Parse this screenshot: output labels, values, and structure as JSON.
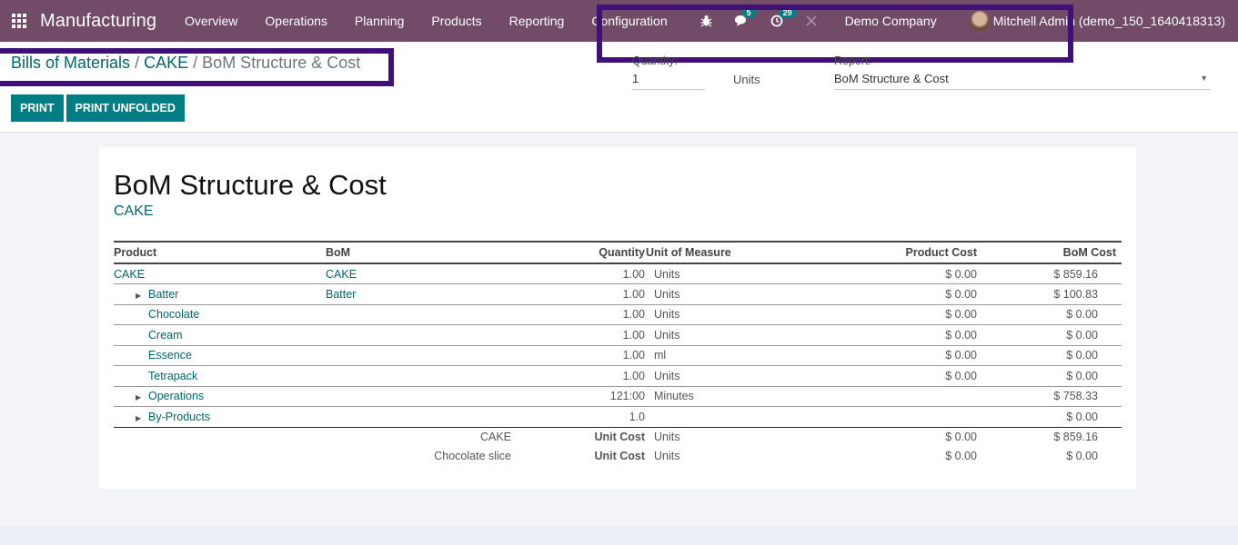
{
  "navbar": {
    "app_name": "Manufacturing",
    "menu": [
      "Overview",
      "Operations",
      "Planning",
      "Products",
      "Reporting",
      "Configuration"
    ],
    "messages_count": "5",
    "activities_count": "29",
    "company": "Demo Company",
    "user": "Mitchell Admin (demo_150_1640418313)"
  },
  "breadcrumb": {
    "items": [
      "Bills of Materials",
      "CAKE"
    ],
    "separator": "/",
    "active": "BoM Structure & Cost"
  },
  "buttons": {
    "print": "PRINT",
    "print_unfolded": "PRINT UNFOLDED"
  },
  "options": {
    "quantity_label": "Quantity:",
    "quantity_value": "1",
    "units": "Units",
    "report_label": "Report:",
    "report_value": "BoM Structure & Cost"
  },
  "report": {
    "title": "BoM Structure & Cost",
    "product": "CAKE",
    "columns": [
      "Product",
      "BoM",
      "Quantity",
      "Unit of Measure",
      "Product Cost",
      "BoM Cost"
    ],
    "rows": [
      {
        "product": "CAKE",
        "bom": "CAKE",
        "qty": "1.00",
        "uom": "Units",
        "product_cost": "$ 0.00",
        "bom_cost": "$ 859.16",
        "level": 0,
        "expandable": false
      },
      {
        "product": "Batter",
        "bom": "Batter",
        "qty": "1.00",
        "uom": "Units",
        "product_cost": "$ 0.00",
        "bom_cost": "$ 100.83",
        "level": 1,
        "expandable": true
      },
      {
        "product": "Chocolate",
        "bom": "",
        "qty": "1.00",
        "uom": "Units",
        "product_cost": "$ 0.00",
        "bom_cost": "$ 0.00",
        "level": 1,
        "expandable": false
      },
      {
        "product": "Cream",
        "bom": "",
        "qty": "1.00",
        "uom": "Units",
        "product_cost": "$ 0.00",
        "bom_cost": "$ 0.00",
        "level": 1,
        "expandable": false
      },
      {
        "product": "Essence",
        "bom": "",
        "qty": "1.00",
        "uom": "ml",
        "product_cost": "$ 0.00",
        "bom_cost": "$ 0.00",
        "level": 1,
        "expandable": false
      },
      {
        "product": "Tetrapack",
        "bom": "",
        "qty": "1.00",
        "uom": "Units",
        "product_cost": "$ 0.00",
        "bom_cost": "$ 0.00",
        "level": 1,
        "expandable": false
      },
      {
        "product": "Operations",
        "bom": "",
        "qty": "121:00",
        "uom": "Minutes",
        "product_cost": "",
        "bom_cost": "$ 758.33",
        "level": 1,
        "expandable": true
      },
      {
        "product": "By-Products",
        "bom": "",
        "qty": "1.0",
        "uom": "",
        "product_cost": "",
        "bom_cost": "$ 0.00",
        "level": 1,
        "expandable": true
      }
    ],
    "footer": [
      {
        "name": "CAKE",
        "label": "Unit Cost",
        "uom": "Units",
        "product_cost": "$ 0.00",
        "bom_cost": "$ 859.16"
      },
      {
        "name": "Chocolate slice",
        "label": "Unit Cost",
        "uom": "Units",
        "product_cost": "$ 0.00",
        "bom_cost": "$ 0.00"
      }
    ]
  }
}
